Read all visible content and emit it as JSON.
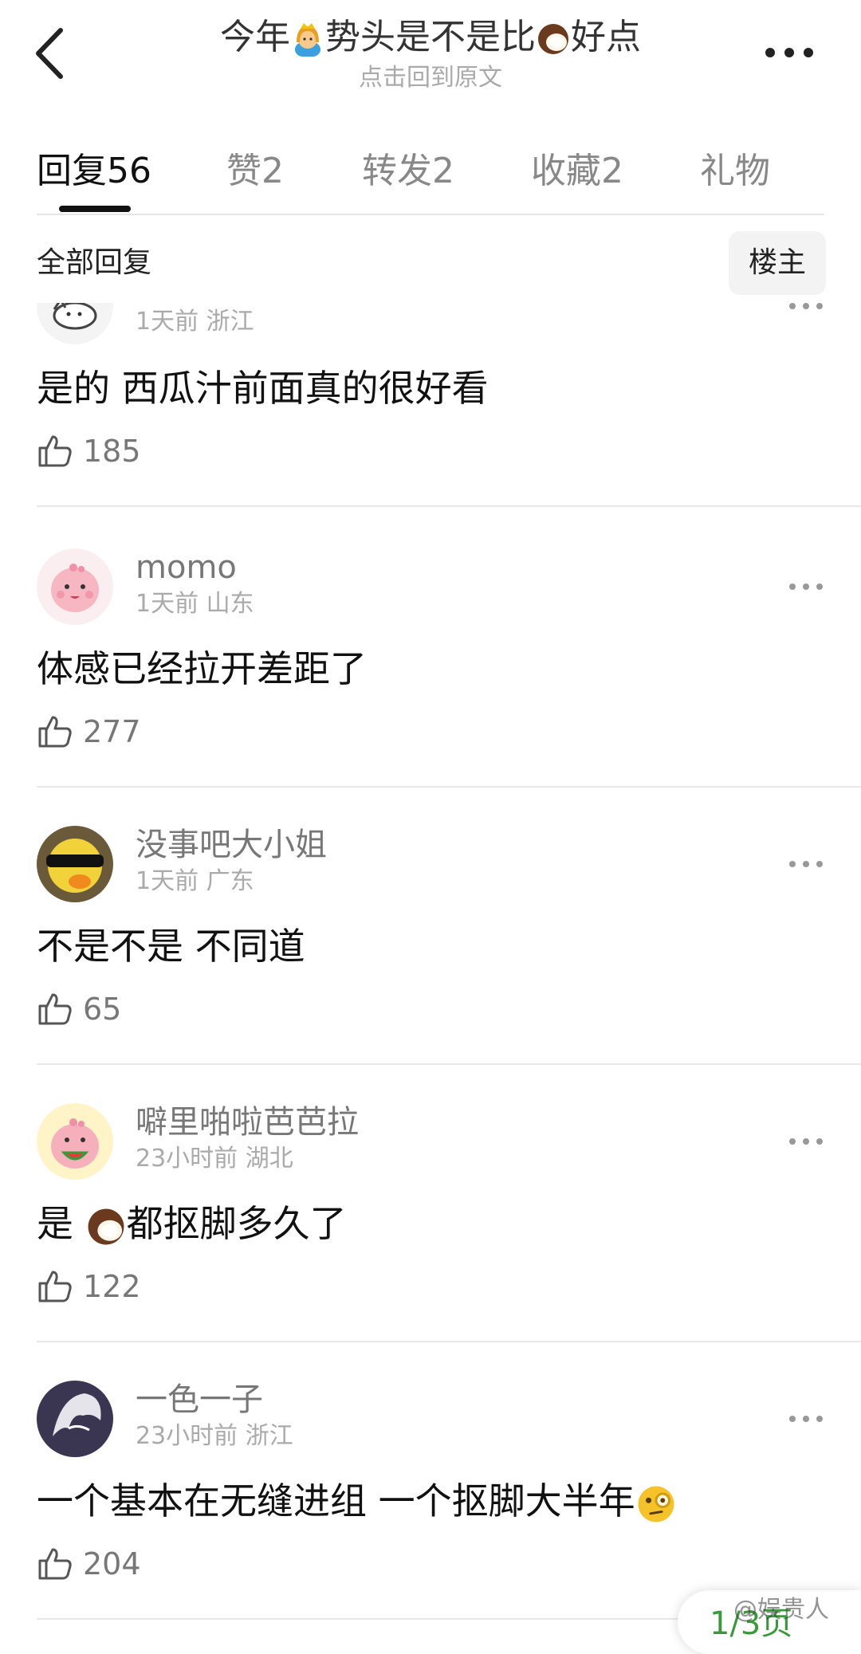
{
  "header": {
    "title_parts": [
      "今年",
      "势头是不是比",
      "好点"
    ],
    "title_emoji_1": "princess-emoji",
    "title_emoji_2": "coconut-emoji",
    "subtitle": "点击回到原文"
  },
  "tabs": [
    {
      "label": "回复",
      "count": "56",
      "active": true
    },
    {
      "label": "赞",
      "count": "2"
    },
    {
      "label": "转发",
      "count": "2"
    },
    {
      "label": "收藏",
      "count": "2"
    },
    {
      "label": "礼物",
      "count": ""
    }
  ],
  "filter": {
    "all_replies": "全部回复",
    "op_only": "楼主"
  },
  "comments": [
    {
      "username": "momo",
      "time": "1天前",
      "region": "浙江",
      "text": "是的 西瓜汁前面真的很好看",
      "likes": "185",
      "avatar_icon": "cartoon-sketch-avatar"
    },
    {
      "username": "momo",
      "time": "1天前",
      "region": "山东",
      "text": "体感已经拉开差距了",
      "likes": "277",
      "avatar_icon": "pink-dino-avatar"
    },
    {
      "username": "没事吧大小姐",
      "time": "1天前",
      "region": "广东",
      "text": "不是不是 不同道",
      "likes": "65",
      "avatar_icon": "sunglasses-duck-avatar"
    },
    {
      "username": "噼里啪啦芭芭拉",
      "time": "23小时前",
      "region": "湖北",
      "text_parts": [
        "是 ",
        "都抠脚多久了"
      ],
      "text_emoji": "coconut-emoji",
      "likes": "122",
      "avatar_icon": "pink-dino-watermelon-avatar"
    },
    {
      "username": "一色一子",
      "time": "23小时前",
      "region": "浙江",
      "text_parts": [
        "一个基本在无缝进组 一个抠脚大半年"
      ],
      "text_emoji": "monocle-face-emoji",
      "likes": "204",
      "avatar_icon": "silver-hair-avatar"
    }
  ],
  "page_indicator": "1/3页",
  "watermark": "@娱贵人",
  "colors": {
    "text_primary": "#111111",
    "text_secondary": "#777777",
    "text_tertiary": "#aaaaaa",
    "divider": "#e8e8e8",
    "page_green": "#3a9a3a"
  }
}
